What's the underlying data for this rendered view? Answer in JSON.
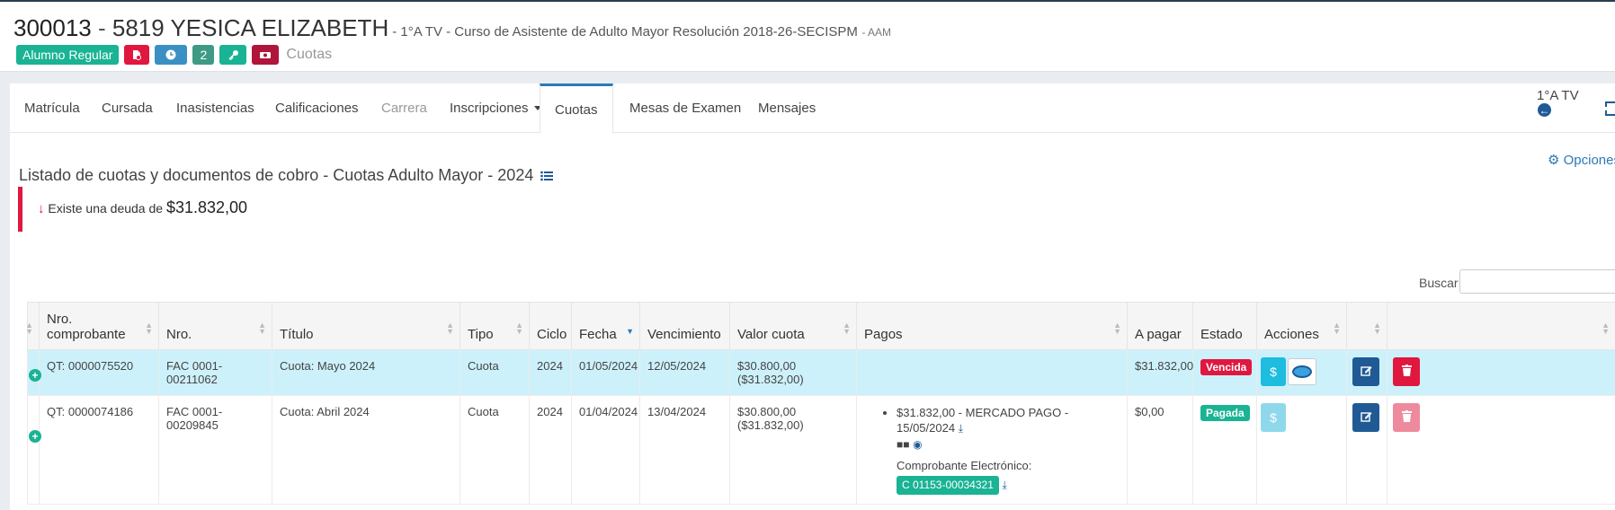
{
  "header": {
    "id": "300013",
    "separator": " - ",
    "name": "5819 YESICA ELIZABETH",
    "course": "- 1°A TV - Curso de Asistente de Adulto Mayor Resolución 2018-26-SECISPM",
    "course_code": "- AAM",
    "status_badge": "Alumno Regular",
    "count_badge": "2",
    "crumb": "Cuotas"
  },
  "tabs": [
    {
      "label": "Matrícula"
    },
    {
      "label": "Cursada"
    },
    {
      "label": "Inasistencias"
    },
    {
      "label": "Calificaciones"
    },
    {
      "label": "Carrera"
    },
    {
      "label": "Inscripciones"
    },
    {
      "label": "Cuotas"
    },
    {
      "label": "Mesas de Examen"
    },
    {
      "label": "Mensajes"
    }
  ],
  "course_short": "1°A TV",
  "opciones_label": "Opciones",
  "list_title": "Listado de cuotas y documentos de cobro - Cuotas Adulto Mayor - 2024",
  "alert": {
    "text": "Existe una deuda de",
    "amount": "$31.832,00"
  },
  "search": {
    "label": "Buscar:",
    "placeholder": ""
  },
  "table": {
    "headers": [
      "Nro. comprobante",
      "Nro.",
      "Título",
      "Tipo",
      "Ciclo",
      "Fecha",
      "Vencimiento",
      "Valor cuota",
      "Pagos",
      "A pagar",
      "Estado",
      "Acciones"
    ],
    "rows": [
      {
        "comprobante": "QT: 0000075520",
        "nro": "FAC 0001-00211062",
        "titulo": "Cuota: Mayo 2024",
        "tipo": "Cuota",
        "ciclo": "2024",
        "fecha": "01/05/2024",
        "vencimiento": "12/05/2024",
        "valor": "$30.800,00",
        "valor_total": "($31.832,00)",
        "a_pagar": "$31.832,00",
        "estado": "Vencida",
        "pay_label": "$"
      },
      {
        "comprobante": "QT: 0000074186",
        "nro": "FAC 0001-00209845",
        "titulo": "Cuota: Abril 2024",
        "tipo": "Cuota",
        "ciclo": "2024",
        "fecha": "01/04/2024",
        "vencimiento": "13/04/2024",
        "valor": "$30.800,00",
        "valor_total": "($31.832,00)",
        "pago": "$31.832,00 - MERCADO PAGO - 15/05/2024",
        "comprobante_label": "Comprobante Electrónico:",
        "comprobante_nro": "C 01153-00034321",
        "a_pagar": "$0,00",
        "estado": "Pagada",
        "pay_label": "$"
      }
    ]
  },
  "colors": {
    "accent": "#2a7ab8",
    "teal": "#1ab394",
    "danger": "#e0173e",
    "highlight_row": "#cdf1fb"
  }
}
